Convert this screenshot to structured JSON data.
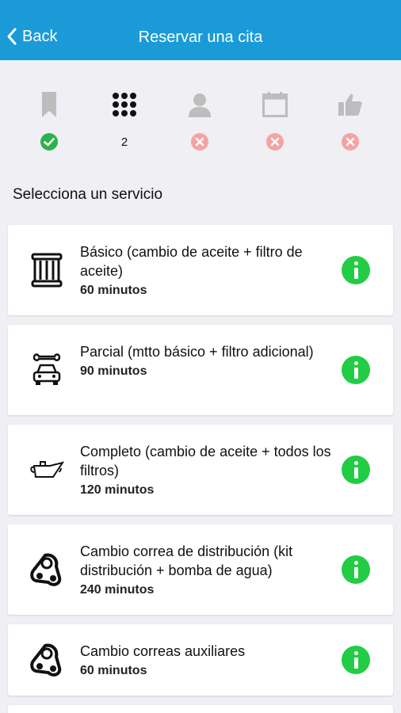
{
  "nav": {
    "back_label": "Back",
    "title": "Reservar una cita"
  },
  "steps": [
    {
      "icon": "bookmark-icon",
      "status": "done"
    },
    {
      "icon": "grid-icon",
      "status": "current",
      "number": "2"
    },
    {
      "icon": "person-icon",
      "status": "pending"
    },
    {
      "icon": "calendar-icon",
      "status": "pending"
    },
    {
      "icon": "thumbs-up-icon",
      "status": "pending"
    }
  ],
  "section_title": "Selecciona un servicio",
  "services": [
    {
      "name": "Básico (cambio de aceite + filtro de aceite)",
      "duration": "60 minutos",
      "icon": "oil-filter-icon"
    },
    {
      "name": "Parcial (mtto básico + filtro adicional)",
      "duration": "90 minutos",
      "icon": "car-wrench-icon"
    },
    {
      "name": "Completo (cambio de aceite + todos los filtros)",
      "duration": "120 minutos",
      "icon": "oil-can-icon"
    },
    {
      "name": "Cambio correa de distribución (kit distribución + bomba de agua)",
      "duration": "240 minutos",
      "icon": "timing-belt-icon"
    },
    {
      "name": "Cambio correas auxiliares",
      "duration": "60 minutos",
      "icon": "belt-icon"
    }
  ],
  "colors": {
    "nav_bg": "#1a9bd7",
    "success": "#2bb24c",
    "error": "#f5a3a3",
    "info": "#22cc44",
    "step_inactive": "#bdbdbd"
  }
}
